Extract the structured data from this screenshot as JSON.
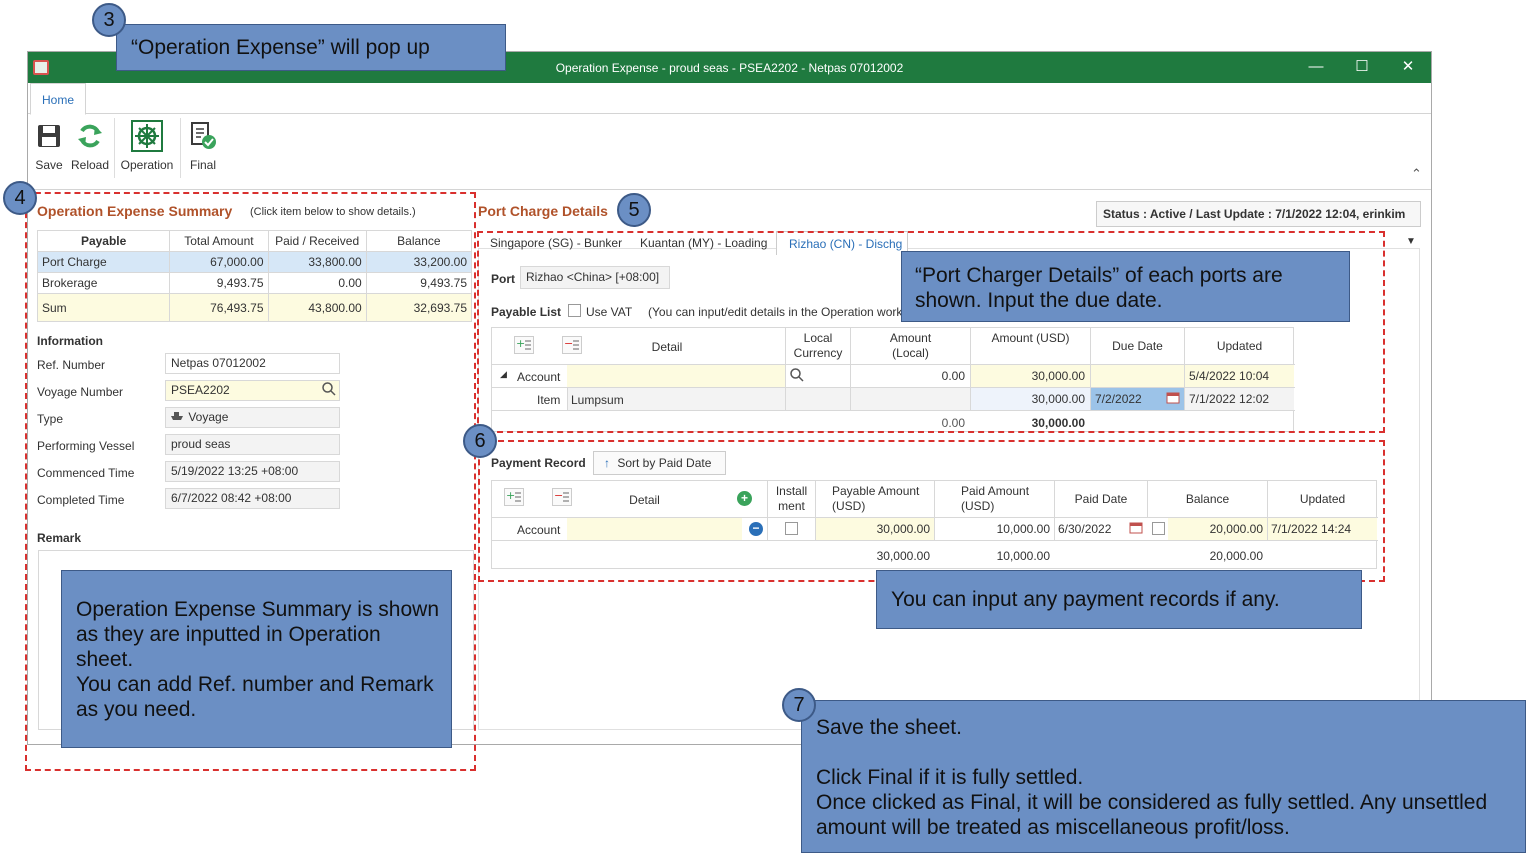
{
  "window": {
    "title": "Operation Expense - proud seas - PSEA2202 - Netpas 07012002",
    "minimize": "—",
    "maximize": "☐",
    "close": "✕"
  },
  "ribbon": {
    "home_tab": "Home",
    "save_label": "Save",
    "reload_label": "Reload",
    "operation_label": "Operation",
    "final_label": "Final",
    "collapse_glyph": "⌃"
  },
  "summary": {
    "title": "Operation Expense Summary",
    "hint": "(Click item below to show details.)",
    "headers": [
      "Payable",
      "Total Amount",
      "Paid / Received",
      "Balance"
    ],
    "rows": [
      {
        "name": "Port Charge",
        "total": "67,000.00",
        "paid": "33,800.00",
        "balance": "33,200.00"
      },
      {
        "name": "Brokerage",
        "total": "9,493.75",
        "paid": "0.00",
        "balance": "9,493.75"
      }
    ],
    "sum": {
      "name": "Sum",
      "total": "76,493.75",
      "paid": "43,800.00",
      "balance": "32,693.75"
    }
  },
  "information": {
    "title": "Information",
    "fields": [
      {
        "label": "Ref. Number",
        "value": "Netpas 07012002"
      },
      {
        "label": "Voyage Number",
        "value": "PSEA2202"
      },
      {
        "label": "Type",
        "value": "Voyage"
      },
      {
        "label": "Performing Vessel",
        "value": "proud seas"
      },
      {
        "label": "Commenced Time",
        "value": "5/19/2022 13:25 +08:00"
      },
      {
        "label": "Completed Time",
        "value": "6/7/2022 08:42 +08:00"
      }
    ],
    "remark_label": "Remark"
  },
  "port_charge": {
    "title": "Port Charge Details",
    "status": "Status : Active /  Last Update : 7/1/2022 12:04, erinkim",
    "tabs": [
      "Singapore (SG) - Bunker",
      "Kuantan (MY) - Loading",
      "Rizhao (CN) - Dischg"
    ],
    "port_label": "Port",
    "port_value": "Rizhao <China> [+08:00]",
    "payable_list_label": "Payable List",
    "use_vat_label": "Use VAT",
    "payable_hint": "(You can input/edit details in the Operation work",
    "payable_headers": {
      "detail": "Detail",
      "local_currency": "Local Currency",
      "amount_local": "Amount (Local)",
      "amount_usd": "Amount (USD)",
      "due_date": "Due Date",
      "updated": "Updated"
    },
    "account_row": {
      "label": "Account",
      "amount_local": "0.00",
      "amount_usd": "30,000.00",
      "updated": "5/4/2022 10:04"
    },
    "item_row": {
      "label": "Item",
      "detail": "Lumpsum",
      "amount_usd": "30,000.00",
      "due_date": "7/2/2022",
      "updated": "7/1/2022 12:02"
    },
    "totals": {
      "local": "0.00",
      "usd": "30,000.00"
    }
  },
  "payment": {
    "title": "Payment Record",
    "sort_button": "Sort by Paid Date",
    "headers": {
      "detail": "Detail",
      "installment": "Install ment",
      "payable": "Payable Amount (USD)",
      "paid": "Paid Amount (USD)",
      "paid_date": "Paid Date",
      "balance": "Balance",
      "updated": "Updated"
    },
    "row": {
      "label": "Account",
      "payable": "30,000.00",
      "paid": "10,000.00",
      "paid_date": "6/30/2022",
      "balance": "20,000.00",
      "updated": "7/1/2022 14:24"
    },
    "totals": {
      "payable": "30,000.00",
      "paid": "10,000.00",
      "balance": "20,000.00"
    }
  },
  "callouts": {
    "c3": {
      "num": "3",
      "text": "“Operation Expense” will pop up"
    },
    "c4": {
      "num": "4",
      "text": "Operation Expense Summary is shown as they are inputted in Operation sheet.\nYou can add Ref. number and Remark as you need."
    },
    "c5": {
      "num": "5",
      "text": "“Port Charger Details” of each ports are shown. Input the due date."
    },
    "c6": {
      "num": "6",
      "text": "You can input any payment records if any."
    },
    "c7": {
      "num": "7",
      "text": "Save the sheet.\n\nClick Final if it is fully settled.\nOnce clicked as Final, it will be considered as fully settled. Any unsettled amount will be treated as miscellaneous profit/loss."
    }
  },
  "colors": {
    "titlebar": "#1f7a3f",
    "accent": "#b0522a",
    "callout": "#6b8fc4",
    "dash": "#d9302e",
    "highlight": "#fdfbe0"
  }
}
